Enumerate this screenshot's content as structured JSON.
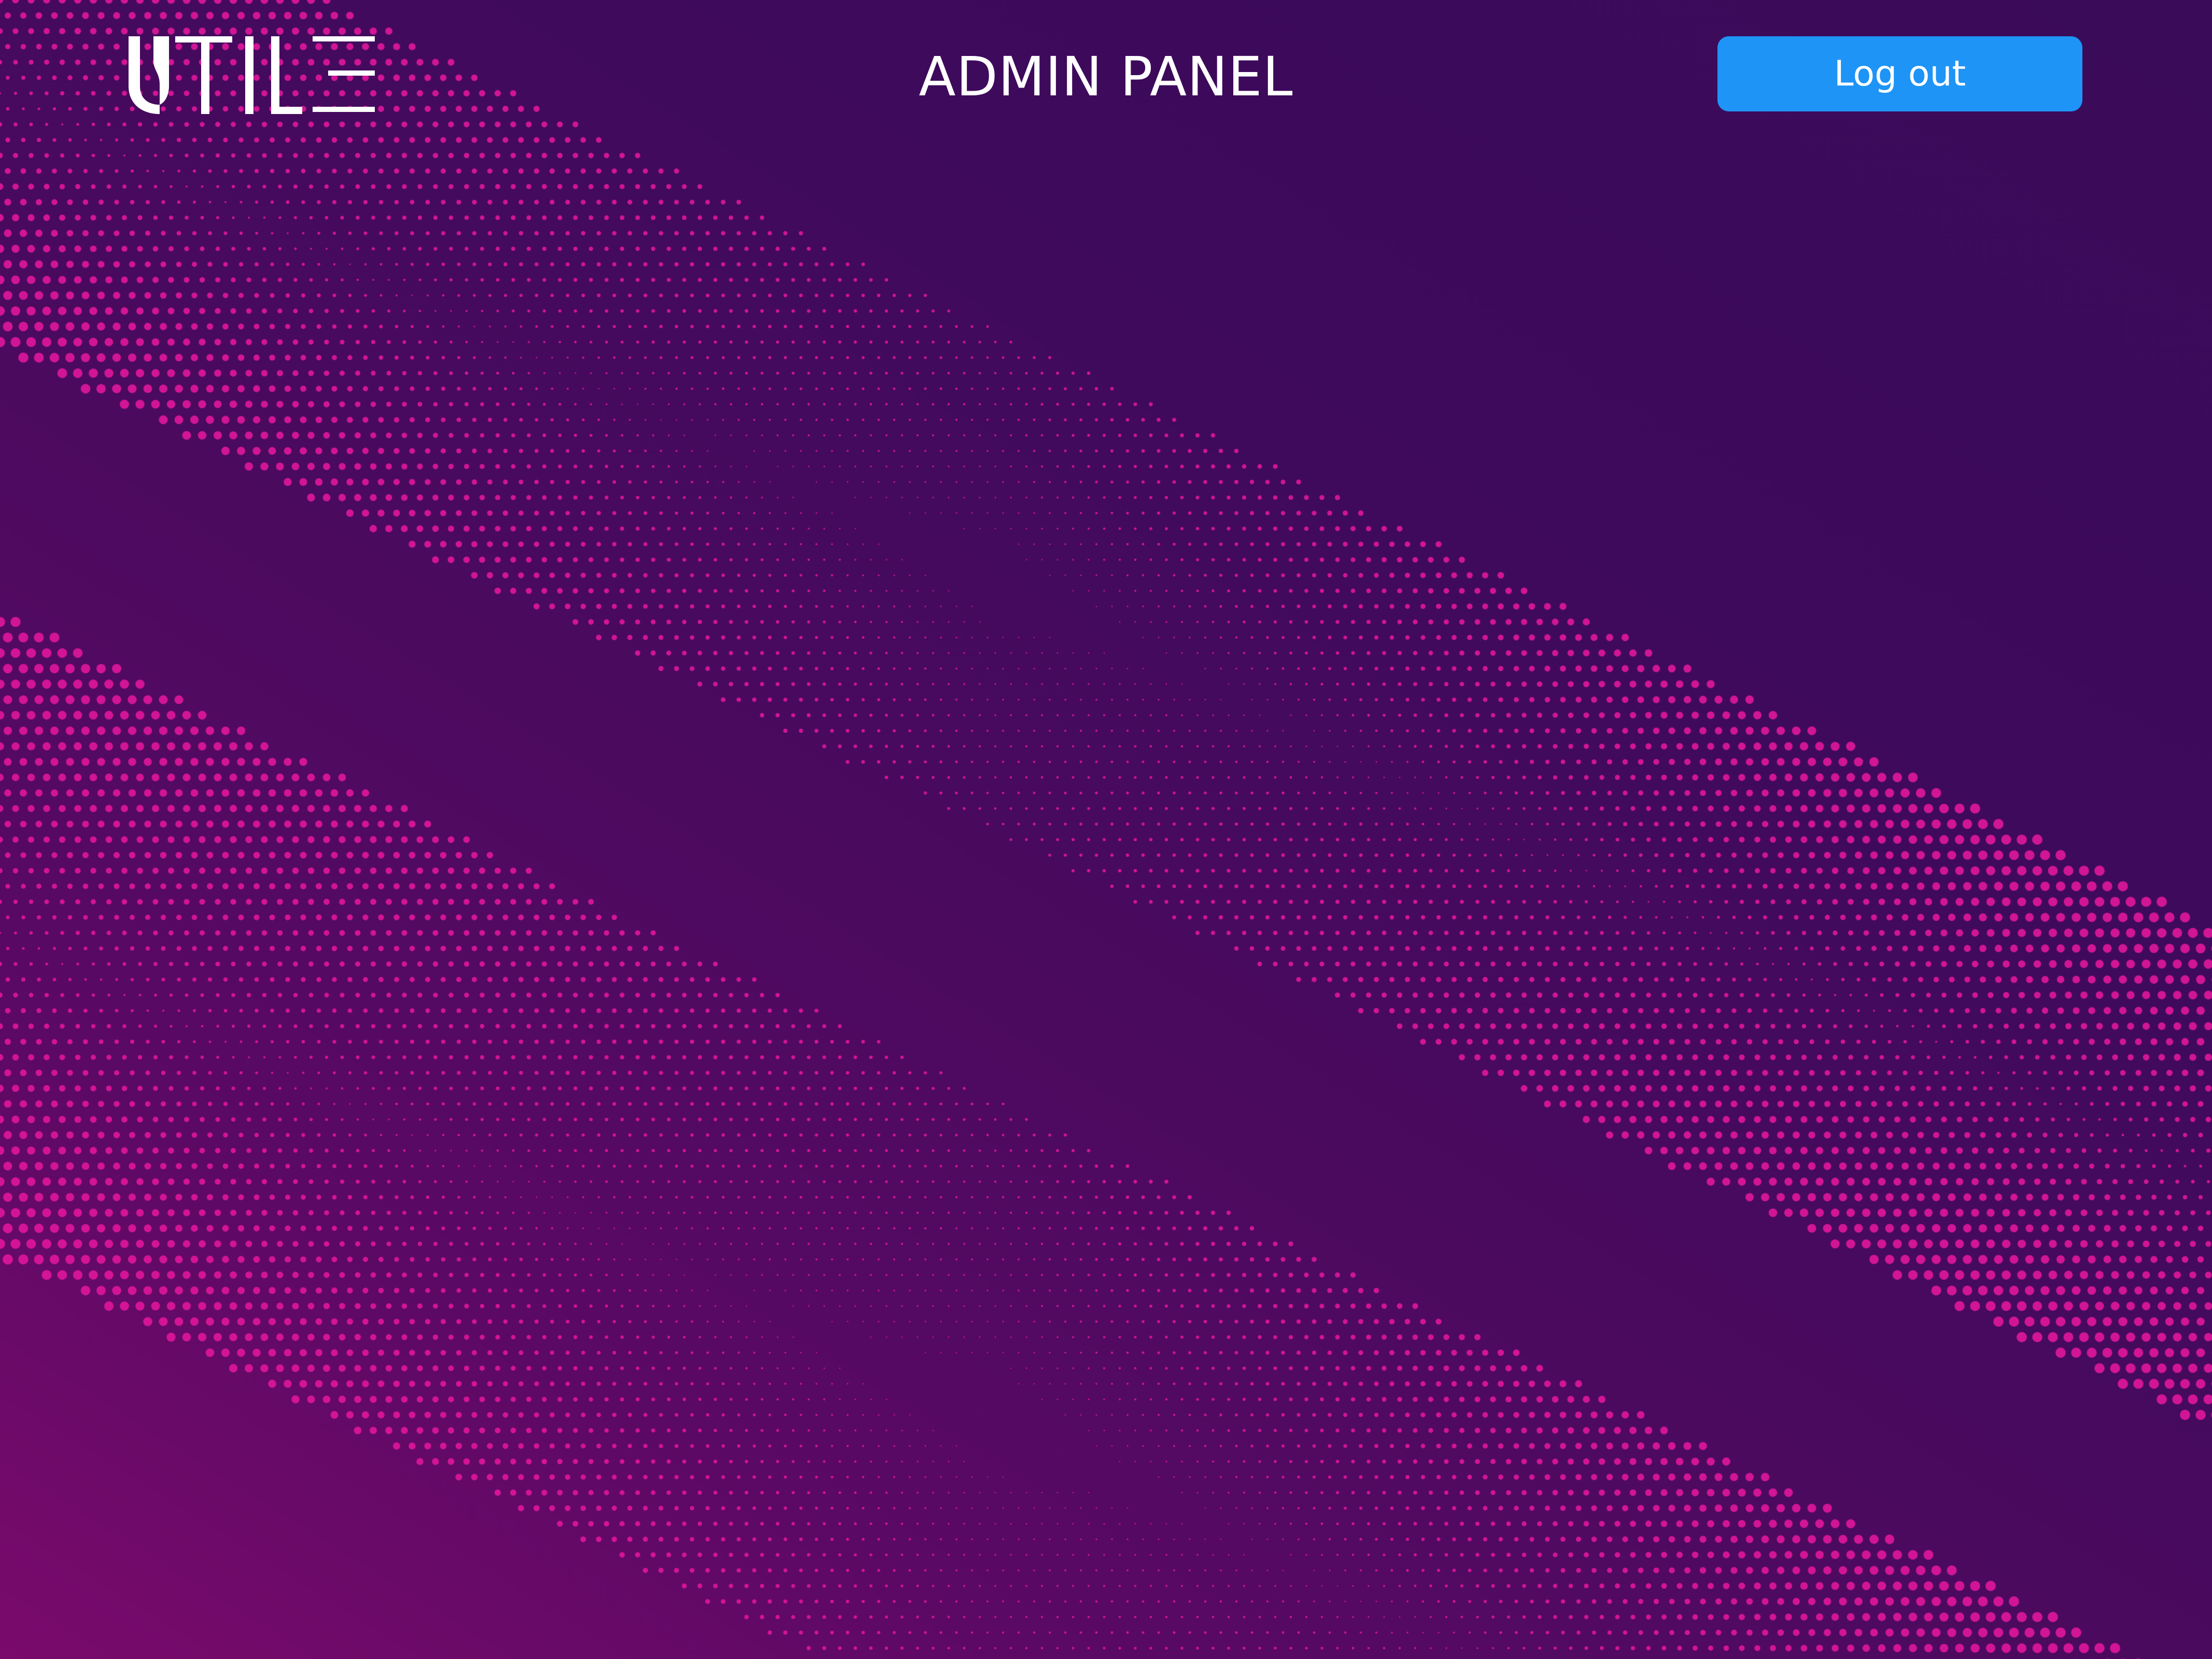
{
  "header": {
    "logo_text": "UTILE",
    "title": "ADMIN PANEL",
    "logout_label": "Log out"
  },
  "colors": {
    "background_dark": "#3e0a5c",
    "background_light": "#7a0a6c",
    "dot_pattern": "#e0169c",
    "accent_button": "#1e94f7",
    "text": "#ffffff"
  }
}
